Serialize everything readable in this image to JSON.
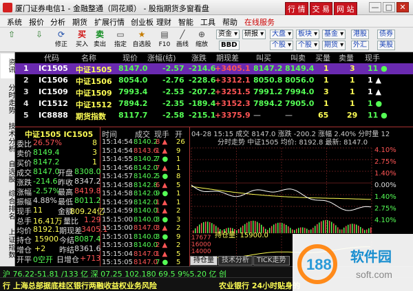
{
  "window": {
    "title": "厦门证券电信1 - 金融整通（同花顺） - 股指期货多窗看盘",
    "buttons": [
      "行 情",
      "交 易",
      "网 站"
    ],
    "controls": [
      "—",
      "□",
      "✕"
    ]
  },
  "menu": [
    "系统",
    "报价",
    "分析",
    "期货",
    "扩展行情",
    "创业板",
    "理财",
    "智能",
    "工具",
    "帮助",
    "在线服务"
  ],
  "toolbar": {
    "buttons": [
      {
        "icon": "up-arrow-icon",
        "label": "修正"
      },
      {
        "icon": "down-arrow-icon",
        "label": ""
      },
      {
        "icon": "rebuild-icon",
        "label": "修正"
      },
      {
        "icon": "buy-icon",
        "label": "买入"
      },
      {
        "icon": "sell-icon",
        "label": "卖出"
      },
      {
        "icon": "market-icon",
        "label": "指定"
      },
      {
        "icon": "self-select-icon",
        "label": "自选股"
      },
      {
        "icon": "f10-icon",
        "label": "F10"
      },
      {
        "icon": "draw-line-icon",
        "label": "画线"
      },
      {
        "icon": "zoom-icon",
        "label": "缩放"
      }
    ],
    "row1": [
      "资金",
      "研报",
      "大盘",
      "板块",
      "基金",
      "港股",
      "债券"
    ],
    "row2": [
      "BBD",
      "个股",
      "个股",
      "期货",
      "外汇",
      "美股"
    ]
  },
  "left_tabs": [
    "资讯",
    "分时走势",
    "技术分析",
    "自选股",
    "综合排名",
    "上证指数"
  ],
  "quote_table": {
    "headers": [
      "代码",
      "名称",
      "现价",
      "涨幅(结)",
      "涨跌",
      "期现差",
      "叫买",
      "叫卖",
      "买量",
      "卖量",
      "现手"
    ],
    "rows": [
      {
        "idx": "1",
        "code": "IC1505",
        "name": "中证1505",
        "price": "8147.0",
        "pct": "-2.57",
        "chg": "-214.6",
        "basis": "+3405.1",
        "bid": "8147.2",
        "ask": "8149.4",
        "bidv": "1",
        "askv": "3",
        "vol": "11 ●"
      },
      {
        "idx": "2",
        "code": "IC1506",
        "name": "中证1506",
        "price": "8054.0",
        "pct": "-2.76",
        "chg": "-228.6",
        "basis": "+3312.1",
        "bid": "8050.8",
        "ask": "8056.0",
        "bidv": "1",
        "askv": "1",
        "vol": "1 ▲"
      },
      {
        "idx": "3",
        "code": "IC1509",
        "name": "中证1509",
        "price": "7993.4",
        "pct": "-2.53",
        "chg": "-207.2",
        "basis": "+3251.5",
        "bid": "7991.2",
        "ask": "7994.0",
        "bidv": "3",
        "askv": "1",
        "vol": "1 ▲"
      },
      {
        "idx": "4",
        "code": "IC1512",
        "name": "中证1512",
        "price": "7894.2",
        "pct": "-2.35",
        "chg": "-189.4",
        "basis": "+3152.3",
        "bid": "7894.2",
        "ask": "7905.0",
        "bidv": "1",
        "askv": "1",
        "vol": "1 ●"
      },
      {
        "idx": "5",
        "code": "IC8888",
        "name": "期货指数",
        "price": "8117.7",
        "pct": "-2.58",
        "chg": "-215.1",
        "basis": "+3375.9",
        "bid": "—",
        "ask": "—",
        "bidv": "65",
        "askv": "29",
        "vol": "11 ●"
      }
    ]
  },
  "detail": {
    "title": "中证1505 IC1505",
    "rows": [
      {
        "label": "委比",
        "value": "26.57%",
        "value2": "8"
      },
      {
        "label": "卖价",
        "value": "8149.4",
        "value2": "3"
      },
      {
        "label": "买价",
        "value": "8147.2",
        "value2": "1"
      },
      {
        "label": "成交",
        "value": "8147.0",
        "label2": "开盘",
        "value3": "8308.0"
      },
      {
        "label": "涨跌",
        "value": "-214.6",
        "label2": "昨收",
        "value3": "8347.2"
      },
      {
        "label": "涨幅",
        "value": "-2.57%",
        "label2": "最高",
        "value3": "8419.8"
      },
      {
        "label": "振幅",
        "value": "4.88%",
        "label2": "最低",
        "value3": "8011.2"
      },
      {
        "label": "现手",
        "value": "11",
        "label2": "金额",
        "value3": "809.24亿"
      },
      {
        "label": "总手",
        "value": "16.41万",
        "label2": "量比",
        "value3": "1.29"
      },
      {
        "label": "均价",
        "value": "8192.1",
        "label2": "期现差",
        "value3": "3405.1"
      },
      {
        "label": "持仓",
        "value": "15900",
        "label2": "今结",
        "value3": "8087.4"
      },
      {
        "label": "增仓",
        "value": "+2",
        "label2": "昨结",
        "value3": "8361.6"
      },
      {
        "label": "开平",
        "value": "0空开",
        "label2": "日增仓",
        "value3": "+713"
      },
      {
        "label": "昨持",
        "value": "15187",
        "label2": "300涨幅",
        "value3": "7%"
      }
    ]
  },
  "ticks": {
    "headers": [
      "时间",
      "成交",
      "现手",
      "开"
    ],
    "rows": [
      {
        "time": "15:14:54",
        "price": "8140.2",
        "vol": "8 ▲",
        "open": "26"
      },
      {
        "time": "15:14:54",
        "price": "8143.6",
        "vol": "1 ▲",
        "open": "9"
      },
      {
        "time": "15:14:55",
        "price": "8140.2",
        "vol": "7 ●",
        "open": "1"
      },
      {
        "time": "15:14:56",
        "price": "8142.0",
        "vol": "7 ▲",
        "open": "1"
      },
      {
        "time": "15:14:57",
        "price": "8140.2",
        "vol": "5 ●",
        "open": "8"
      },
      {
        "time": "15:14:58",
        "price": "8142.8",
        "vol": "6 ▲",
        "open": "5"
      },
      {
        "time": "15:14:58",
        "price": "8142.0",
        "vol": "9 ●",
        "open": "1"
      },
      {
        "time": "15:14:59",
        "price": "8142.0",
        "vol": "1 ▲",
        "open": "1"
      },
      {
        "time": "15:14:59",
        "price": "8140.0",
        "vol": "1 ▲",
        "open": "2"
      },
      {
        "time": "15:15:00",
        "price": "8140.0",
        "vol": "3 ●",
        "open": "3"
      },
      {
        "time": "15:15:00",
        "price": "8147.0",
        "vol": "3 ▲",
        "open": "2"
      },
      {
        "time": "15:15:01",
        "price": "8140.0",
        "vol": "3 ●",
        "open": "9"
      },
      {
        "time": "15:15:03",
        "price": "8140.0",
        "vol": "2 ▲",
        "open": "2"
      },
      {
        "time": "15:15:04",
        "price": "8147.0",
        "vol": "1 ▲",
        "open": "5"
      },
      {
        "time": "15:15:05",
        "price": "8147.0",
        "vol": "7 ●",
        "open": "5"
      }
    ]
  },
  "chart": {
    "header": "04-28 15:15 成交 8147.0 涨跌 -200.2 涨幅 2.40% 分时量 12",
    "subheader": "分时走势  中证1505 均价: 8192.8 最新: 8147.0",
    "right_axis": [
      "4.10%",
      "2.75%",
      "1.40%",
      "0.00%",
      "1.40%",
      "2.75%",
      "4.10%"
    ],
    "left_axis": [
      "8689.4",
      "8576.9",
      "8461.4",
      "8347.2",
      "8232.6",
      "8118.1",
      "8003.6"
    ],
    "position_label": "持仓量: 15900.0",
    "position_axis": [
      "17677",
      "16000",
      "14000"
    ],
    "tabs": [
      "持仓量",
      "技术分析",
      "TICK走势"
    ]
  },
  "status": {
    "bar1": "沪 76.22-51.81 /133 亿  深 07.25 102.180 69.5 9%5.20 亿  创",
    "bar2_left": "行 上海总部据底桂区银行两融收益权业务风险",
    "bar2_right": "农业银行 24小时贴身的"
  },
  "watermark": {
    "number": "188",
    "text": "软件园",
    "url": "soft.com"
  }
}
